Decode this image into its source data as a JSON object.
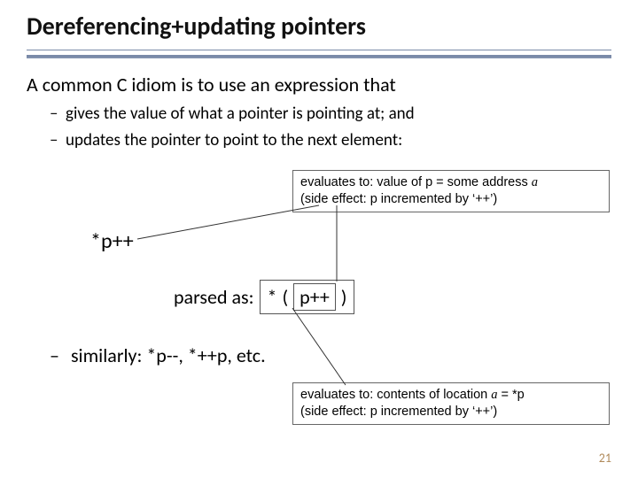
{
  "title": "Dereferencing+updating pointers",
  "intro": "A common C idiom is to use an expression that",
  "bullets": [
    "gives the value of what a pointer is pointing at; and",
    "updates the pointer to point to the next element:"
  ],
  "expr_main": "*p++",
  "parsed": {
    "label": "parsed as:",
    "star": "*",
    "lparen": "(",
    "inner": "p++",
    "rparen": ")"
  },
  "similarly": "similarly: *p--, *++p, etc.",
  "note_top": {
    "line1_a": "evaluates to: value of p = some address ",
    "line1_var": "a",
    "line2": "(side effect: p incremented by ‘++’)"
  },
  "note_bottom": {
    "line1_a": "evaluates to: contents of location ",
    "line1_var": "a",
    "line1_b": " = *p",
    "line2": "(side effect: p incremented by ‘++’)"
  },
  "page_number": "21"
}
